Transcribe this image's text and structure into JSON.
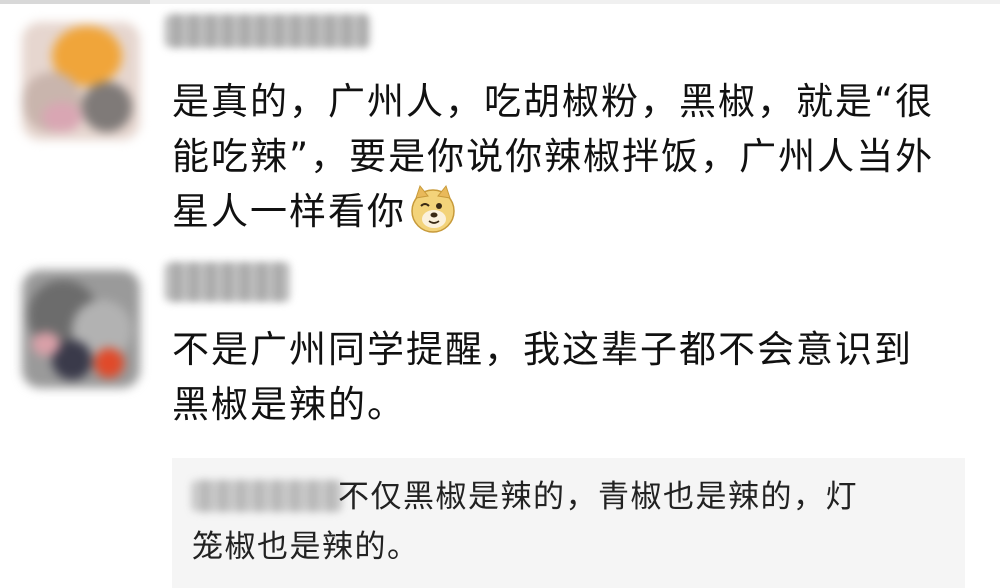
{
  "comments": [
    {
      "lines": [
        "是真的，广州人，吃胡椒粉，黑椒，就是“很",
        "能吃辣”，要是你说你辣椒拌饭，广州人当外",
        "星人一样看你"
      ],
      "emoji": "doge-icon"
    },
    {
      "lines": [
        "不是广州同学提醒，我这辈子都不会意识到",
        "黑椒是辣的。"
      ],
      "reply": {
        "lines": [
          "不仅黑椒是辣的，青椒也是辣的，灯",
          "笼椒也是辣的。"
        ]
      }
    }
  ]
}
